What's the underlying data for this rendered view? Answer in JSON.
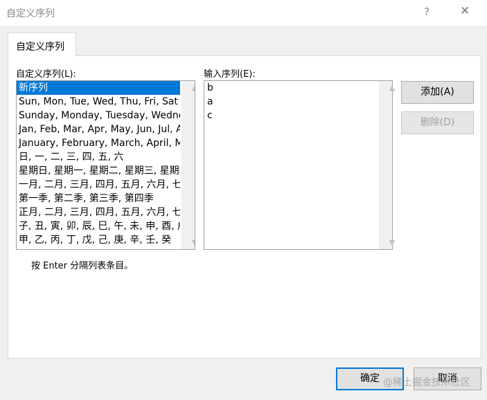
{
  "window": {
    "title": "自定义序列",
    "help_icon": "?",
    "close_icon": "✕"
  },
  "tab": {
    "label": "自定义序列"
  },
  "left": {
    "label": "自定义序列(L):",
    "items": [
      "新序列",
      "Sun, Mon, Tue, Wed, Thu, Fri, Sat",
      "Sunday, Monday, Tuesday, Wednesday",
      "Jan, Feb, Mar, Apr, May, Jun, Jul, Aug",
      "January, February, March, April, May",
      "日, 一, 二, 三, 四, 五, 六",
      "星期日, 星期一, 星期二, 星期三, 星期四",
      "一月, 二月, 三月, 四月, 五月, 六月, 七月",
      "第一季, 第二季, 第三季, 第四季",
      "正月, 二月, 三月, 四月, 五月, 六月, 七月",
      "子, 丑, 寅, 卯, 辰, 巳, 午, 未, 申, 酉, 戌",
      "甲, 乙, 丙, 丁, 戊, 己, 庚, 辛, 壬, 癸"
    ]
  },
  "right": {
    "label": "输入序列(E):",
    "lines": [
      "b",
      "a",
      "c"
    ]
  },
  "buttons": {
    "add": "添加(A)",
    "delete": "删除(D)",
    "ok": "确定",
    "cancel": "取消"
  },
  "hint": "按 Enter 分隔列表条目。",
  "watermark": "@稀土掘金技术社区"
}
